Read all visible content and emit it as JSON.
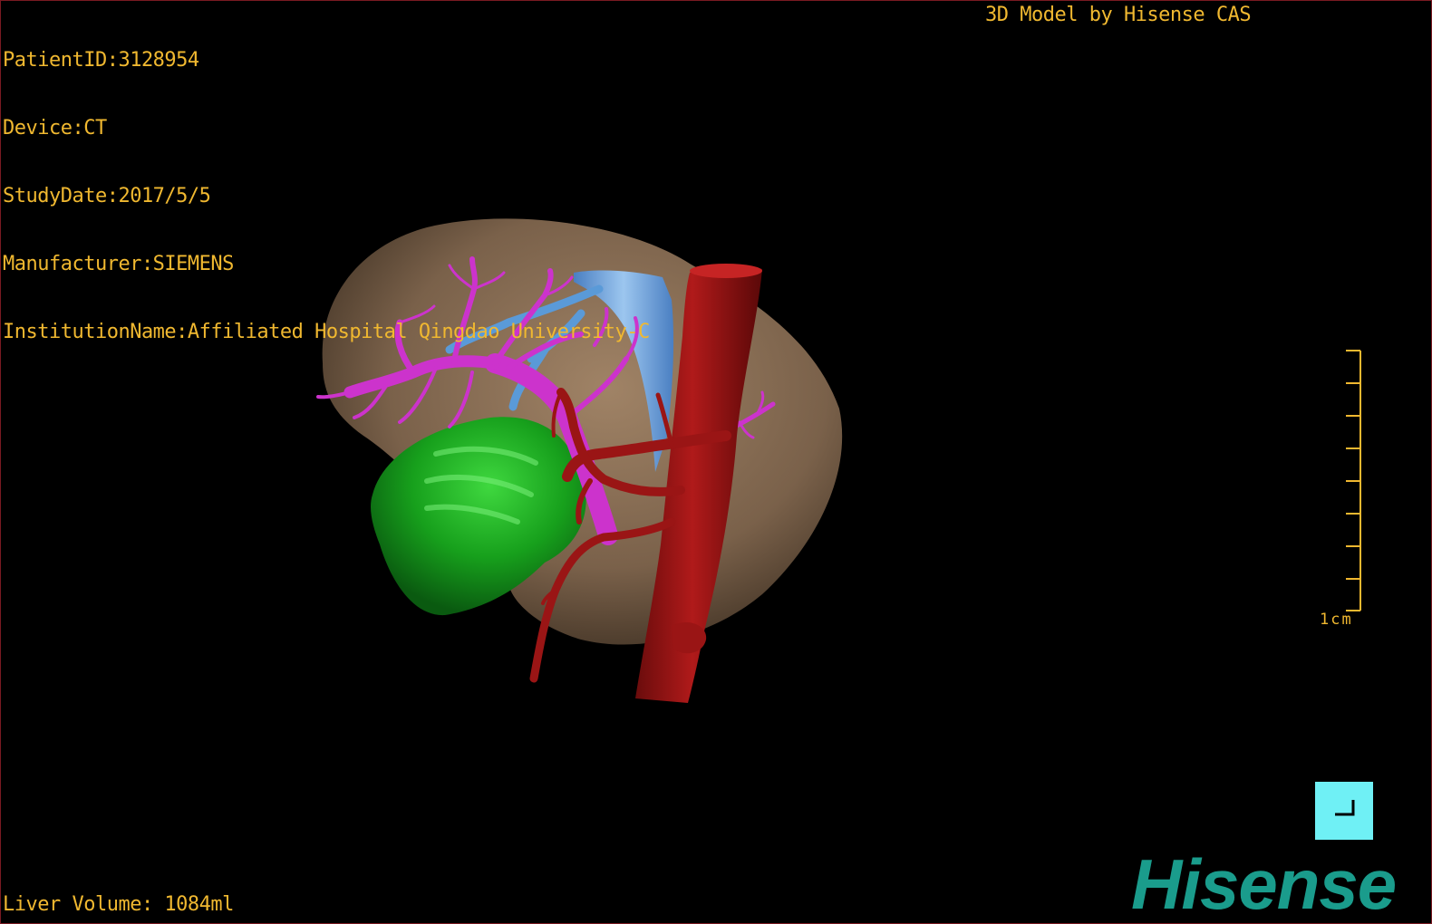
{
  "info": {
    "patient_id": "PatientID:3128954",
    "device": "Device:CT",
    "study_date": "StudyDate:2017/5/5",
    "manufacturer": "Manufacturer:SIEMENS",
    "institution": "InstitutionName:Affiliated Hospital Qingdao University-C"
  },
  "credit": "3D Model by Hisense CAS",
  "liver_volume": "Liver Volume: 1084ml",
  "scale_bar": {
    "label": "1cm"
  },
  "logo": "Hisense",
  "colors": {
    "overlay_text": "#f0b830",
    "liver": "#8a7055",
    "gallbladder": "#19a21f",
    "portal_vein": "#cc33cc",
    "hepatic_vein": "#5a9ad8",
    "artery": "#9a1515",
    "orientation_button": "#6ff0f5",
    "logo": "#1a9c8c"
  },
  "icons": {
    "orientation": "orientation-reset-icon"
  }
}
